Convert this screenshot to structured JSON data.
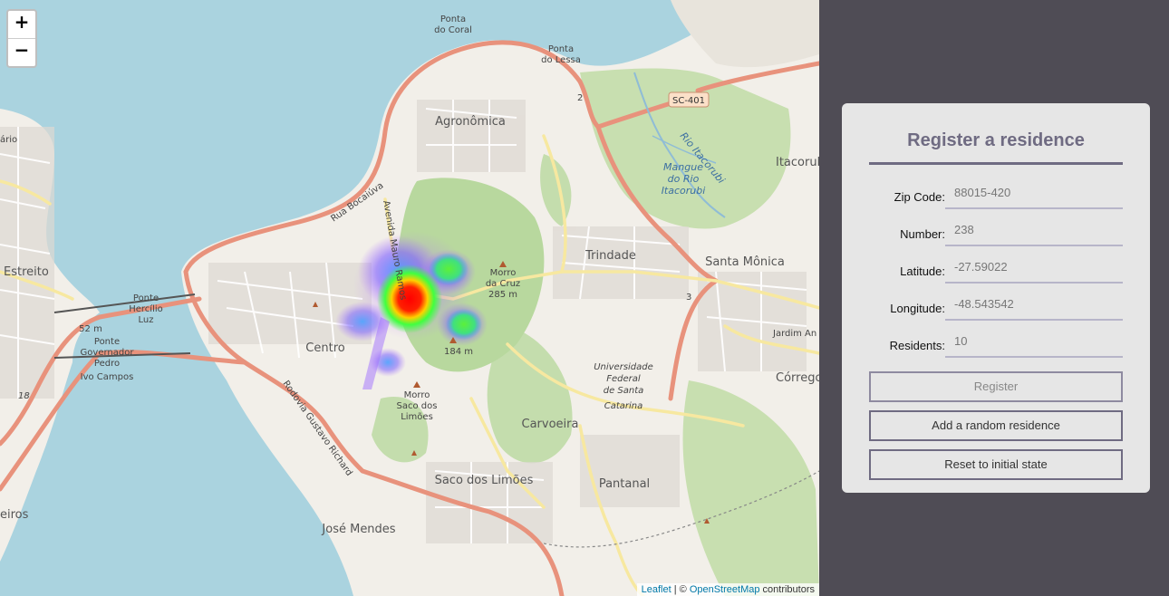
{
  "map": {
    "zoom_in": "+",
    "zoom_out": "−",
    "attribution": {
      "leaflet": "Leaflet",
      "sep": " | © ",
      "osm": "OpenStreetMap",
      "contributors": " contributors"
    },
    "labels": {
      "ponta_coral_1": "Ponta",
      "ponta_coral_2": "do Coral",
      "ponta_lessa_1": "Ponta",
      "ponta_lessa_2": "do Lessa",
      "sc401": "SC-401",
      "agronomica": "Agronômica",
      "rio_itacorubi": "Rio Itacorubi",
      "mangue_1": "Mangue",
      "mangue_2": "do Rio",
      "mangue_3": "Itacorubi",
      "itacorubi": "Itacorubi",
      "trindade": "Trindade",
      "santa_monica": "Santa Mônica",
      "estreito": "Estreito",
      "ponte_hl_1": "Ponte",
      "ponte_hl_2": "Hercílio",
      "ponte_hl_3": "Luz",
      "ponte_gpic_1": "Ponte",
      "ponte_gpic_2": "Governador",
      "ponte_gpic_3": "Pedro",
      "ponte_gpic_4": "Ivo Campos",
      "m52": "52 m",
      "centro": "Centro",
      "morro_cruz_1": "Morro",
      "morro_cruz_2": "da Cruz",
      "morro_cruz_3": "285 m",
      "m184": "184 m",
      "ufsc_1": "Universidade",
      "ufsc_2": "Federal",
      "ufsc_3": "de Santa",
      "ufsc_4": "Catarina",
      "jardim": "Jardim An",
      "corrego": "Córrego",
      "morro_saco_1": "Morro",
      "morro_saco_2": "Saco dos",
      "morro_saco_3": "Limões",
      "carvoeira": "Carvoeira",
      "saco_limoes": "Saco dos Limões",
      "pantanal": "Pantanal",
      "jose_mendes": "José Mendes",
      "rua_bocaiuva": "Rua Bocaiúva",
      "av_mauro_ramos": "Avenida Mauro Ramos",
      "rodovia": "Rodovia Gustavo Richard",
      "ario": "ário",
      "eiros": "eiros",
      "route_2": "2",
      "route_3": "3",
      "route_18": "18"
    }
  },
  "form": {
    "title": "Register a residence",
    "fields": [
      {
        "label": "Zip Code:",
        "value": "88015-420"
      },
      {
        "label": "Number:",
        "value": "238"
      },
      {
        "label": "Latitude:",
        "value": "-27.59022"
      },
      {
        "label": "Longitude:",
        "value": "-48.543542"
      },
      {
        "label": "Residents:",
        "value": "10"
      }
    ],
    "register_label": "Register",
    "random_label": "Add a random residence",
    "reset_label": "Reset to initial state"
  },
  "colors": {
    "accent": "#6f6b82",
    "panel_bg": "#e6e6e6",
    "page_bg": "#4f4c55",
    "water": "#aad3df"
  }
}
